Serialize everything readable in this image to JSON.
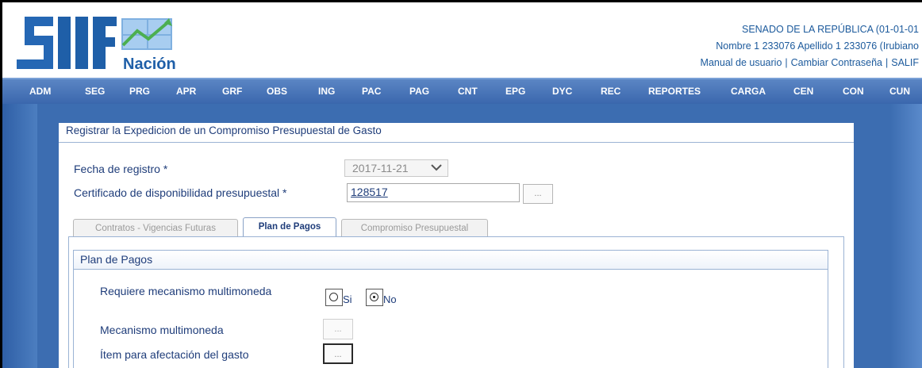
{
  "header": {
    "logo_text": "SIIF Nación",
    "entity": "SENADO DE LA REPÚBLICA (01-01-01",
    "user": "Nombre 1 233076 Apellido 1 233076 (Irubiano",
    "links": {
      "manual": "Manual de usuario",
      "change_password": "Cambiar Contraseña",
      "logout": "SALIF"
    },
    "link_separator": "|"
  },
  "nav": {
    "items": [
      "ADM",
      "SEG",
      "PRG",
      "APR",
      "GRF",
      "OBS",
      "ING",
      "PAC",
      "PAG",
      "CNT",
      "EPG",
      "DYC",
      "REC",
      "REPORTES",
      "CARGA",
      "CEN",
      "CON",
      "CUN"
    ]
  },
  "form": {
    "title": "Registrar la Expedicion de un Compromiso Presupuestal de Gasto",
    "fecha_label": "Fecha de registro *",
    "fecha_value": "2017-11-21",
    "cdp_label": "Certificado de disponibilidad presupuestal *",
    "cdp_value": "128517",
    "dots": "..."
  },
  "tabs": [
    {
      "label": "Contratos - Vigencias Futuras",
      "active": false
    },
    {
      "label": "Plan de Pagos",
      "active": true
    },
    {
      "label": "Compromiso Presupuestal",
      "active": false
    }
  ],
  "plan": {
    "title": "Plan de Pagos",
    "multimoneda_label": "Requiere mecanismo multimoneda",
    "si_label": "Si",
    "no_label": "No",
    "selected": "No",
    "mecanismo_label": "Mecanismo multimoneda",
    "item_label": "Ítem para afectación del gasto"
  },
  "colors": {
    "nav_bg": "#3a67ad",
    "text_blue": "#1f3d7a",
    "link_blue": "#1c5a9c",
    "logo_blue": "#1f5fa8"
  }
}
